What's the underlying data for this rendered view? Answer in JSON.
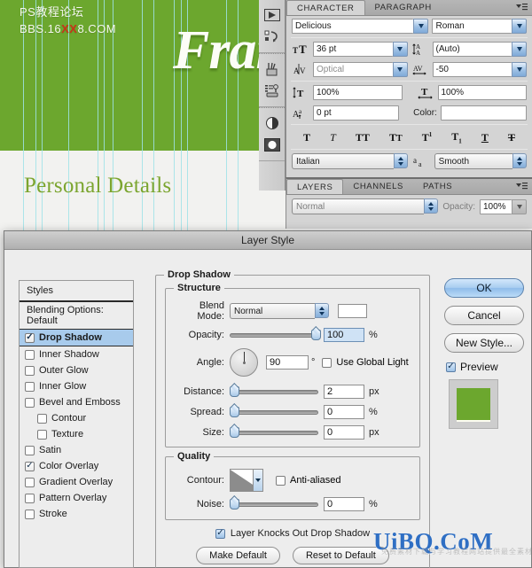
{
  "canvas": {
    "forum_line1": "PS教程论坛",
    "forum_line2a": "BBS.16",
    "forum_line2b": "XX",
    "forum_line2c": "8.COM",
    "heading": "Fran",
    "subheading": "Personal Details",
    "green": "#6ca72e",
    "guide_color": "#9fe3e8"
  },
  "toolstrip": {
    "icons": [
      {
        "name": "play-arrow-icon"
      },
      {
        "name": "animation-icon"
      },
      {
        "name": "brushes-icon"
      },
      {
        "name": "tool-presets-icon"
      },
      {
        "name": "adjustment-half-circle-icon"
      },
      {
        "name": "mask-circle-icon"
      }
    ]
  },
  "character_panel": {
    "tabs": [
      {
        "label": "CHARACTER",
        "active": true
      },
      {
        "label": "PARAGRAPH",
        "active": false
      }
    ],
    "font_family": "Delicious",
    "font_style": "Roman",
    "font_size": "36 pt",
    "leading": "(Auto)",
    "kerning": "Optical",
    "tracking": "-50",
    "vertical_scale": "100%",
    "horizontal_scale": "100%",
    "baseline_shift": "0 pt",
    "color_label": "Color:",
    "color_value": "#ffffff",
    "style_buttons": [
      "T",
      "T",
      "TT",
      "Tr",
      "T¹",
      "T₁",
      "T",
      "T"
    ],
    "language": "Italian",
    "antialias_label": "aa",
    "antialias": "Smooth",
    "icon_labels": {
      "size": "font-size-icon",
      "leading": "leading-icon",
      "kerning": "kerning-icon",
      "tracking": "tracking-icon",
      "vscale": "vertical-scale-icon",
      "hscale": "horizontal-scale-icon",
      "baseline": "baseline-shift-icon"
    }
  },
  "layers_panel": {
    "tabs": [
      {
        "label": "LAYERS",
        "active": true
      },
      {
        "label": "CHANNELS",
        "active": false
      },
      {
        "label": "PATHS",
        "active": false
      }
    ],
    "blend_mode": "Normal",
    "opacity_label": "Opacity:",
    "opacity_value": "100%"
  },
  "dialog": {
    "title": "Layer Style",
    "styles": {
      "header": "Styles",
      "items": [
        {
          "label": "Blending Options: Default",
          "type": "plain",
          "checked": false,
          "selected": false
        },
        {
          "label": "Drop Shadow",
          "type": "check",
          "checked": true,
          "selected": true
        },
        {
          "label": "Inner Shadow",
          "type": "check",
          "checked": false,
          "selected": false
        },
        {
          "label": "Outer Glow",
          "type": "check",
          "checked": false,
          "selected": false
        },
        {
          "label": "Inner Glow",
          "type": "check",
          "checked": false,
          "selected": false
        },
        {
          "label": "Bevel and Emboss",
          "type": "check",
          "checked": false,
          "selected": false
        },
        {
          "label": "Contour",
          "type": "check",
          "checked": false,
          "selected": false,
          "indent": true
        },
        {
          "label": "Texture",
          "type": "check",
          "checked": false,
          "selected": false,
          "indent": true
        },
        {
          "label": "Satin",
          "type": "check",
          "checked": false,
          "selected": false
        },
        {
          "label": "Color Overlay",
          "type": "check",
          "checked": true,
          "selected": false
        },
        {
          "label": "Gradient Overlay",
          "type": "check",
          "checked": false,
          "selected": false
        },
        {
          "label": "Pattern Overlay",
          "type": "check",
          "checked": false,
          "selected": false
        },
        {
          "label": "Stroke",
          "type": "check",
          "checked": false,
          "selected": false
        }
      ]
    },
    "drop_shadow": {
      "group_label": "Drop Shadow",
      "structure_label": "Structure",
      "blend_mode_label": "Blend Mode:",
      "blend_mode_value": "Normal",
      "shadow_color": "#ffffff",
      "opacity_label": "Opacity:",
      "opacity_value": "100",
      "opacity_unit": "%",
      "angle_label": "Angle:",
      "angle_value": "90",
      "angle_unit": "°",
      "use_global_light": "Use Global Light",
      "use_global_light_checked": false,
      "distance_label": "Distance:",
      "distance_value": "2",
      "distance_unit": "px",
      "spread_label": "Spread:",
      "spread_value": "0",
      "spread_unit": "%",
      "size_label": "Size:",
      "size_value": "0",
      "size_unit": "px"
    },
    "quality": {
      "group_label": "Quality",
      "contour_label": "Contour:",
      "anti_aliased": "Anti-aliased",
      "anti_aliased_checked": false,
      "noise_label": "Noise:",
      "noise_value": "0",
      "noise_unit": "%"
    },
    "knocks_out": "Layer Knocks Out Drop Shadow",
    "knocks_out_checked": true,
    "make_default": "Make Default",
    "reset_to_default": "Reset to Default",
    "buttons": {
      "ok": "OK",
      "cancel": "Cancel",
      "new_style": "New Style...",
      "preview": "Preview",
      "preview_checked": true
    },
    "preview_color": "#6ca72e"
  },
  "watermark": {
    "bottom": "UiBQ.CoM",
    "bottom_sub": "免费素材下载与学习教程网站提供最全素材下载"
  }
}
